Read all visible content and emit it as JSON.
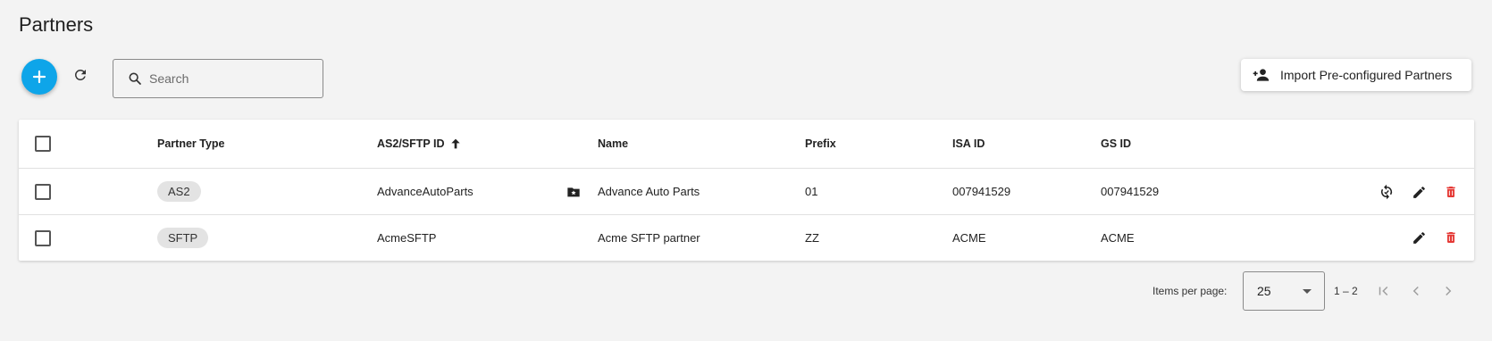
{
  "page": {
    "title": "Partners"
  },
  "toolbar": {
    "add_icon": "plus-icon",
    "refresh_icon": "refresh-icon",
    "search_placeholder": "Search",
    "search_value": "",
    "import_label": "Import Pre-configured Partners",
    "import_icon": "person-add-icon",
    "accent_color": "#0ea5e9"
  },
  "table": {
    "columns": {
      "partner_type": "Partner Type",
      "as2_sftp_id": "AS2/SFTP ID",
      "name": "Name",
      "prefix": "Prefix",
      "isa_id": "ISA ID",
      "gs_id": "GS ID"
    },
    "sort": {
      "column": "as2_sftp_id",
      "direction": "ascending",
      "icon": "arrow-up-icon"
    },
    "rows": [
      {
        "partner_type": "AS2",
        "as2_sftp_id": "AdvanceAutoParts",
        "id_badge_icon": "folder-star-icon",
        "name": "Advance Auto Parts",
        "prefix": "01",
        "isa_id": "007941529",
        "gs_id": "007941529",
        "actions": [
          "sync-icon",
          "edit-icon",
          "delete-icon"
        ]
      },
      {
        "partner_type": "SFTP",
        "as2_sftp_id": "AcmeSFTP",
        "name": "Acme SFTP partner",
        "prefix": "ZZ",
        "isa_id": "ACME",
        "gs_id": "ACME",
        "actions": [
          "edit-icon",
          "delete-icon"
        ]
      }
    ],
    "delete_color": "#e53935"
  },
  "paginator": {
    "items_per_page_label": "Items per page:",
    "page_size": "25",
    "range": "1 – 2"
  }
}
